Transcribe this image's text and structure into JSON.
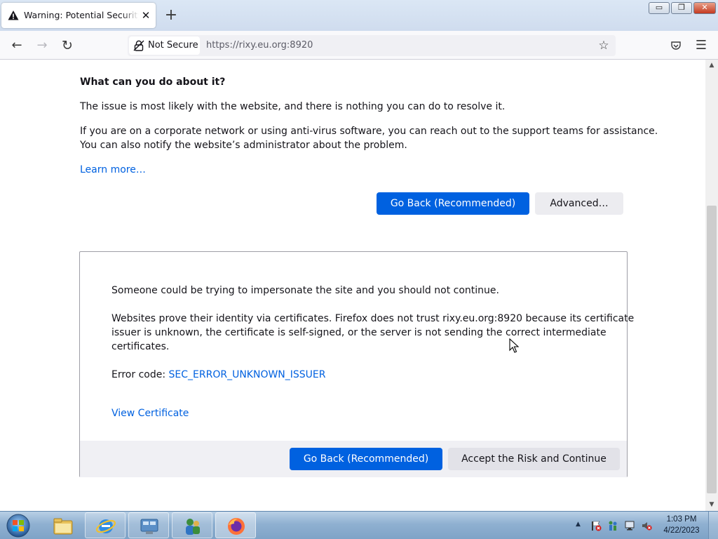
{
  "tab": {
    "title": "Warning: Potential Security Risk Ahead",
    "close": "✕"
  },
  "new_tab": "+",
  "window": {
    "min": "▭",
    "max": "❐",
    "close": "✕"
  },
  "navbar": {
    "security_label": "Not Secure",
    "url": "https://rixy.eu.org:8920"
  },
  "page": {
    "heading": "What can you do about it?",
    "para1": "The issue is most likely with the website, and there is nothing you can do to resolve it.",
    "para2_line1": "If you are on a corporate network or using anti-virus software, you can reach out to the support teams for assistance.",
    "para2_line2": "You can also notify the website’s administrator about the problem.",
    "learn_more": "Learn more…",
    "go_back_label": "Go Back (Recommended)",
    "advanced_label": "Advanced…"
  },
  "advanced": {
    "line1": "Someone could be trying to impersonate the site and you should not continue.",
    "para2_line1": "Websites prove their identity via certificates. Firefox does not trust rixy.eu.org:8920 because its certificate",
    "para2_line2": "issuer is unknown, the certificate is self-signed, or the server is not sending the correct intermediate",
    "para2_line3": "certificates.",
    "error_code_label": "Error code: ",
    "error_code": "SEC_ERROR_UNKNOWN_ISSUER",
    "view_certificate": "View Certificate",
    "go_back_label": "Go Back (Recommended)",
    "accept_label": "Accept the Risk and Continue"
  },
  "taskbar": {
    "apps": [
      "file-explorer",
      "internet-explorer",
      "control-panel",
      "users",
      "firefox"
    ],
    "tray_icons": [
      "action-center-flag-icon",
      "network-icon",
      "display-icon",
      "volume-muted-icon"
    ],
    "clock_time": "1:03 PM",
    "clock_date": "4/22/2023"
  },
  "colors": {
    "accent": "#0061e0",
    "link": "#0061e0"
  }
}
